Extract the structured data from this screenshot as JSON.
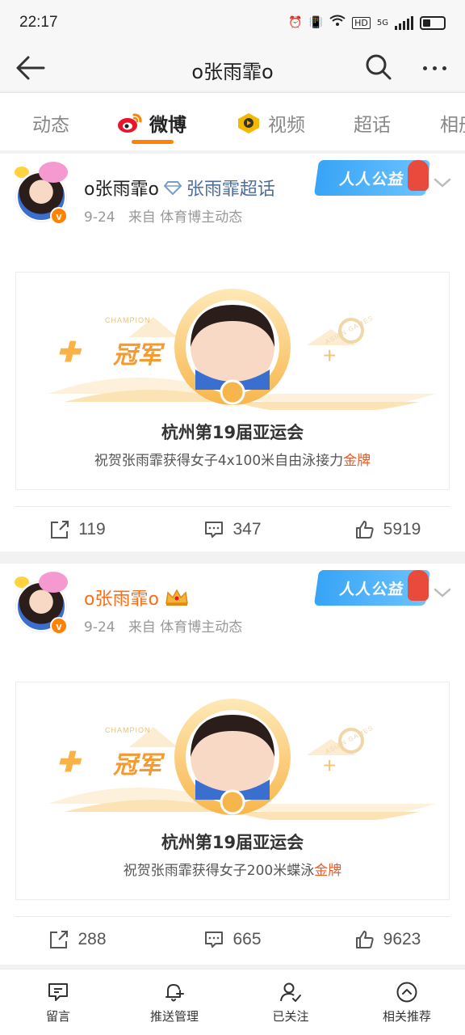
{
  "status_bar": {
    "time": "22:17",
    "network": "5G",
    "hd": "HD"
  },
  "nav": {
    "title": "o张雨霏o"
  },
  "tabs": [
    {
      "label": "动态",
      "active": false
    },
    {
      "label": "微博",
      "active": true,
      "icon": "weibo-icon"
    },
    {
      "label": "视频",
      "active": false,
      "icon": "video-icon"
    },
    {
      "label": "超话",
      "active": false
    },
    {
      "label": "相册",
      "active": false
    }
  ],
  "posts": [
    {
      "username": "o张雨霏o",
      "badge": "v",
      "supertopic": "张雨霏超话",
      "date": "9-24",
      "source": "来自 体育博主动态",
      "charity_badge": "人人公益",
      "banner": {
        "champion_en": "CHAMPION",
        "champion_cn": "冠军",
        "games_en": "ASIAN GAMES",
        "title": "杭州第19届亚运会",
        "subtitle_prefix": "祝贺张雨霏获得女子4x100米自由泳接力",
        "subtitle_highlight": "金牌"
      },
      "reposts": "119",
      "comments": "347",
      "likes": "5919"
    },
    {
      "username": "o张雨霏o",
      "badge": "v",
      "supertopic": "",
      "date": "9-24",
      "source": "来自 体育博主动态",
      "charity_badge": "人人公益",
      "banner": {
        "champion_en": "CHAMPION",
        "champion_cn": "冠军",
        "games_en": "ASIAN GAMES",
        "title": "杭州第19届亚运会",
        "subtitle_prefix": "祝贺张雨霏获得女子200米蝶泳",
        "subtitle_highlight": "金牌"
      },
      "reposts": "288",
      "comments": "665",
      "likes": "9623"
    }
  ],
  "bottom_bar": [
    {
      "label": "留言",
      "icon": "message-icon"
    },
    {
      "label": "推送管理",
      "icon": "bell-plus-icon"
    },
    {
      "label": "已关注",
      "icon": "user-check-icon"
    },
    {
      "label": "相关推荐",
      "icon": "chevron-up-circle-icon"
    }
  ],
  "colors": {
    "accent": "#ff8200",
    "username_orange": "#f86e1a",
    "supertopic": "#4f6f9a",
    "gold_text": "#f15a24"
  }
}
